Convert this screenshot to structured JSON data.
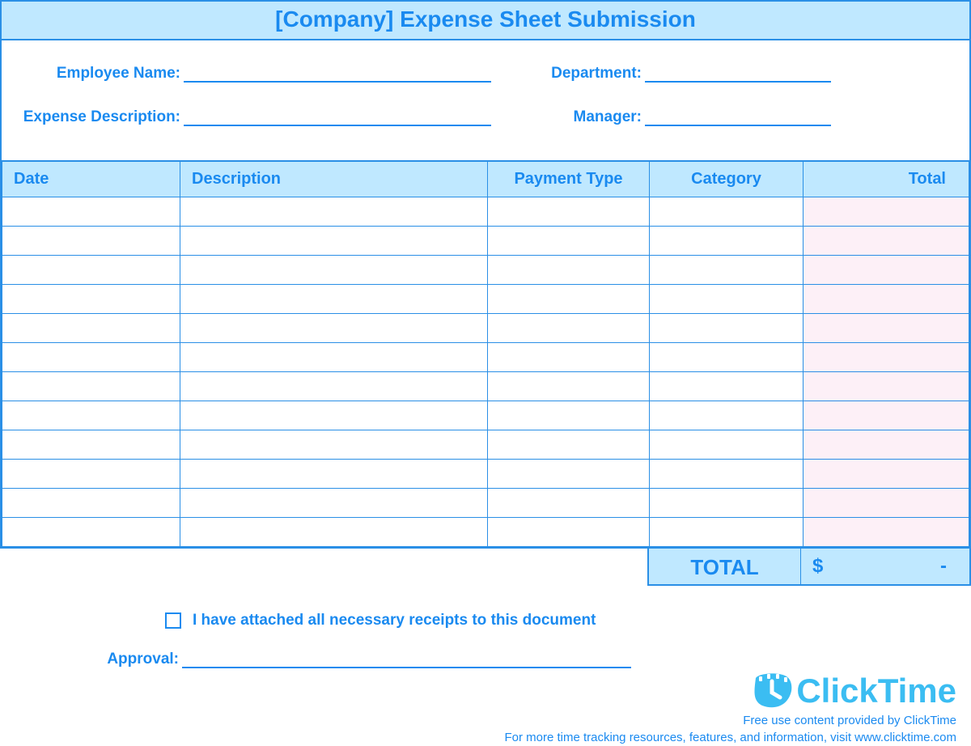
{
  "title": "[Company] Expense Sheet Submission",
  "fields": {
    "employee_name_label": "Employee Name:",
    "department_label": "Department:",
    "expense_description_label": "Expense Description:",
    "manager_label": "Manager:",
    "employee_name_value": "",
    "department_value": "",
    "expense_description_value": "",
    "manager_value": ""
  },
  "columns": {
    "date": "Date",
    "description": "Description",
    "payment_type": "Payment Type",
    "category": "Category",
    "total": "Total"
  },
  "rows": [
    {
      "date": "",
      "description": "",
      "payment_type": "",
      "category": "",
      "total": ""
    },
    {
      "date": "",
      "description": "",
      "payment_type": "",
      "category": "",
      "total": ""
    },
    {
      "date": "",
      "description": "",
      "payment_type": "",
      "category": "",
      "total": ""
    },
    {
      "date": "",
      "description": "",
      "payment_type": "",
      "category": "",
      "total": ""
    },
    {
      "date": "",
      "description": "",
      "payment_type": "",
      "category": "",
      "total": ""
    },
    {
      "date": "",
      "description": "",
      "payment_type": "",
      "category": "",
      "total": ""
    },
    {
      "date": "",
      "description": "",
      "payment_type": "",
      "category": "",
      "total": ""
    },
    {
      "date": "",
      "description": "",
      "payment_type": "",
      "category": "",
      "total": ""
    },
    {
      "date": "",
      "description": "",
      "payment_type": "",
      "category": "",
      "total": ""
    },
    {
      "date": "",
      "description": "",
      "payment_type": "",
      "category": "",
      "total": ""
    },
    {
      "date": "",
      "description": "",
      "payment_type": "",
      "category": "",
      "total": ""
    },
    {
      "date": "",
      "description": "",
      "payment_type": "",
      "category": "",
      "total": ""
    }
  ],
  "grand": {
    "label": "TOTAL",
    "currency": "$",
    "value": "-"
  },
  "attach": {
    "checked": false,
    "text": "I have attached all necessary receipts to this document"
  },
  "approval_label": "Approval:",
  "approval_value": "",
  "brand": "ClickTime",
  "credit1": "Free use content provided by ClickTime",
  "credit2": "For more time tracking resources, features, and information, visit www.clicktime.com"
}
